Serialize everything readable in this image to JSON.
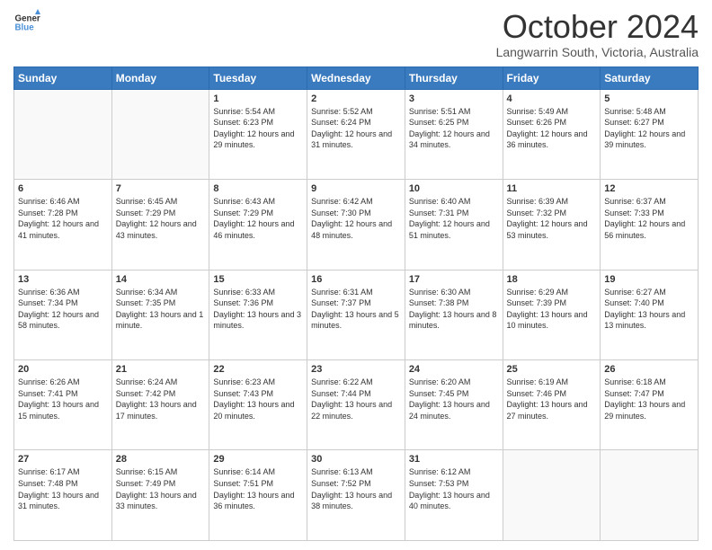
{
  "header": {
    "logo_line1": "General",
    "logo_line2": "Blue",
    "month": "October 2024",
    "location": "Langwarrin South, Victoria, Australia"
  },
  "weekdays": [
    "Sunday",
    "Monday",
    "Tuesday",
    "Wednesday",
    "Thursday",
    "Friday",
    "Saturday"
  ],
  "weeks": [
    [
      {
        "day": "",
        "info": ""
      },
      {
        "day": "",
        "info": ""
      },
      {
        "day": "1",
        "info": "Sunrise: 5:54 AM\nSunset: 6:23 PM\nDaylight: 12 hours\nand 29 minutes."
      },
      {
        "day": "2",
        "info": "Sunrise: 5:52 AM\nSunset: 6:24 PM\nDaylight: 12 hours\nand 31 minutes."
      },
      {
        "day": "3",
        "info": "Sunrise: 5:51 AM\nSunset: 6:25 PM\nDaylight: 12 hours\nand 34 minutes."
      },
      {
        "day": "4",
        "info": "Sunrise: 5:49 AM\nSunset: 6:26 PM\nDaylight: 12 hours\nand 36 minutes."
      },
      {
        "day": "5",
        "info": "Sunrise: 5:48 AM\nSunset: 6:27 PM\nDaylight: 12 hours\nand 39 minutes."
      }
    ],
    [
      {
        "day": "6",
        "info": "Sunrise: 6:46 AM\nSunset: 7:28 PM\nDaylight: 12 hours\nand 41 minutes."
      },
      {
        "day": "7",
        "info": "Sunrise: 6:45 AM\nSunset: 7:29 PM\nDaylight: 12 hours\nand 43 minutes."
      },
      {
        "day": "8",
        "info": "Sunrise: 6:43 AM\nSunset: 7:29 PM\nDaylight: 12 hours\nand 46 minutes."
      },
      {
        "day": "9",
        "info": "Sunrise: 6:42 AM\nSunset: 7:30 PM\nDaylight: 12 hours\nand 48 minutes."
      },
      {
        "day": "10",
        "info": "Sunrise: 6:40 AM\nSunset: 7:31 PM\nDaylight: 12 hours\nand 51 minutes."
      },
      {
        "day": "11",
        "info": "Sunrise: 6:39 AM\nSunset: 7:32 PM\nDaylight: 12 hours\nand 53 minutes."
      },
      {
        "day": "12",
        "info": "Sunrise: 6:37 AM\nSunset: 7:33 PM\nDaylight: 12 hours\nand 56 minutes."
      }
    ],
    [
      {
        "day": "13",
        "info": "Sunrise: 6:36 AM\nSunset: 7:34 PM\nDaylight: 12 hours\nand 58 minutes."
      },
      {
        "day": "14",
        "info": "Sunrise: 6:34 AM\nSunset: 7:35 PM\nDaylight: 13 hours\nand 1 minute."
      },
      {
        "day": "15",
        "info": "Sunrise: 6:33 AM\nSunset: 7:36 PM\nDaylight: 13 hours\nand 3 minutes."
      },
      {
        "day": "16",
        "info": "Sunrise: 6:31 AM\nSunset: 7:37 PM\nDaylight: 13 hours\nand 5 minutes."
      },
      {
        "day": "17",
        "info": "Sunrise: 6:30 AM\nSunset: 7:38 PM\nDaylight: 13 hours\nand 8 minutes."
      },
      {
        "day": "18",
        "info": "Sunrise: 6:29 AM\nSunset: 7:39 PM\nDaylight: 13 hours\nand 10 minutes."
      },
      {
        "day": "19",
        "info": "Sunrise: 6:27 AM\nSunset: 7:40 PM\nDaylight: 13 hours\nand 13 minutes."
      }
    ],
    [
      {
        "day": "20",
        "info": "Sunrise: 6:26 AM\nSunset: 7:41 PM\nDaylight: 13 hours\nand 15 minutes."
      },
      {
        "day": "21",
        "info": "Sunrise: 6:24 AM\nSunset: 7:42 PM\nDaylight: 13 hours\nand 17 minutes."
      },
      {
        "day": "22",
        "info": "Sunrise: 6:23 AM\nSunset: 7:43 PM\nDaylight: 13 hours\nand 20 minutes."
      },
      {
        "day": "23",
        "info": "Sunrise: 6:22 AM\nSunset: 7:44 PM\nDaylight: 13 hours\nand 22 minutes."
      },
      {
        "day": "24",
        "info": "Sunrise: 6:20 AM\nSunset: 7:45 PM\nDaylight: 13 hours\nand 24 minutes."
      },
      {
        "day": "25",
        "info": "Sunrise: 6:19 AM\nSunset: 7:46 PM\nDaylight: 13 hours\nand 27 minutes."
      },
      {
        "day": "26",
        "info": "Sunrise: 6:18 AM\nSunset: 7:47 PM\nDaylight: 13 hours\nand 29 minutes."
      }
    ],
    [
      {
        "day": "27",
        "info": "Sunrise: 6:17 AM\nSunset: 7:48 PM\nDaylight: 13 hours\nand 31 minutes."
      },
      {
        "day": "28",
        "info": "Sunrise: 6:15 AM\nSunset: 7:49 PM\nDaylight: 13 hours\nand 33 minutes."
      },
      {
        "day": "29",
        "info": "Sunrise: 6:14 AM\nSunset: 7:51 PM\nDaylight: 13 hours\nand 36 minutes."
      },
      {
        "day": "30",
        "info": "Sunrise: 6:13 AM\nSunset: 7:52 PM\nDaylight: 13 hours\nand 38 minutes."
      },
      {
        "day": "31",
        "info": "Sunrise: 6:12 AM\nSunset: 7:53 PM\nDaylight: 13 hours\nand 40 minutes."
      },
      {
        "day": "",
        "info": ""
      },
      {
        "day": "",
        "info": ""
      }
    ]
  ]
}
